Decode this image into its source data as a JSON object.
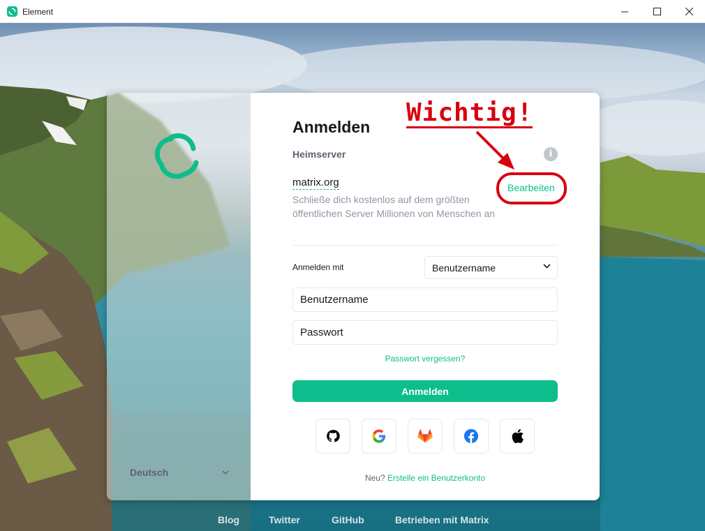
{
  "window": {
    "title": "Element"
  },
  "sidebar": {
    "language": "Deutsch"
  },
  "login": {
    "title": "Anmelden",
    "homeserver_label": "Heimserver",
    "homeserver_name": "matrix.org",
    "homeserver_description": "Schließe dich kostenlos auf dem größten öffentlichen Server Millionen von Menschen an",
    "edit_label": "Bearbeiten",
    "login_with_label": "Anmelden mit",
    "login_with_value": "Benutzername",
    "username_placeholder": "Benutzername",
    "password_placeholder": "Passwort",
    "forgot_password": "Passwort vergessen?",
    "submit_label": "Anmelden",
    "sso_providers": [
      "github-icon",
      "google-icon",
      "gitlab-icon",
      "facebook-icon",
      "apple-icon"
    ],
    "signup_prefix": "Neu?",
    "signup_link": "Erstelle ein Benutzerkonto"
  },
  "annotation": {
    "text": "Wichtig!",
    "color": "#d7000f"
  },
  "footer": {
    "links": [
      "Blog",
      "Twitter",
      "GitHub",
      "Betrieben mit Matrix"
    ]
  },
  "colors": {
    "accent": "#0dbd8b",
    "text": "#17191c",
    "muted": "#8d97a5"
  }
}
